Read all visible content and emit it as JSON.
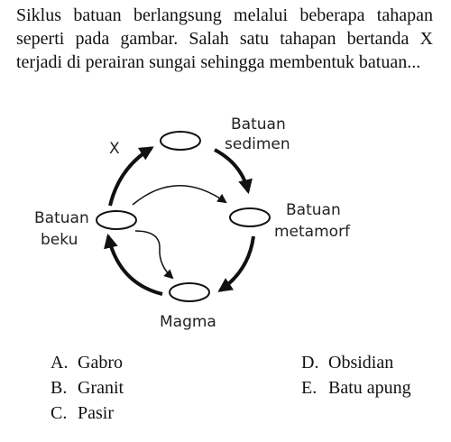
{
  "question": {
    "text": "Siklus batuan berlangsung melalui beberapa tahapan seperti pada gambar. Salah satu tahapan bertanda X terjadi di perairan sungai sehingga membentuk batuan..."
  },
  "diagram": {
    "marker_x": "X",
    "sedimen_line1": "Batuan",
    "sedimen_line2": "sedimen",
    "metamorf_line1": "Batuan",
    "metamorf_line2": "metamorf",
    "beku_line1": "Batuan",
    "beku_line2": "beku",
    "magma": "Magma"
  },
  "options": [
    {
      "letter": "A.",
      "text": "Gabro"
    },
    {
      "letter": "B.",
      "text": "Granit"
    },
    {
      "letter": "C.",
      "text": "Pasir"
    },
    {
      "letter": "D.",
      "text": "Obsidian"
    },
    {
      "letter": "E.",
      "text": "Batu apung"
    }
  ]
}
